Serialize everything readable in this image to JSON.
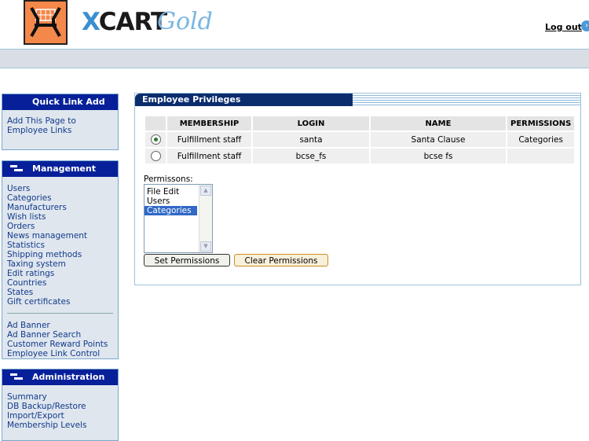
{
  "header": {
    "brand_x": "X",
    "brand_cart": "CART",
    "brand_gold": "Gold",
    "logout_label": "Log out"
  },
  "menus": {
    "quick_link": {
      "title": "Quick Link Add",
      "items": [
        "Add This Page to Employee Links"
      ]
    },
    "management": {
      "title": "Management",
      "items_a": [
        "Users",
        "Categories",
        "Manufacturers",
        "Wish lists",
        "Orders",
        "News management",
        "Statistics",
        "Shipping methods",
        "Taxing system",
        "Edit ratings",
        "Countries",
        "States",
        "Gift certificates"
      ],
      "items_b": [
        "Ad Banner",
        "Ad Banner Search",
        "Customer Reward Points",
        "Employee Link Control"
      ]
    },
    "administration": {
      "title": "Administration",
      "items": [
        "Summary",
        "DB Backup/Restore",
        "Import/Export",
        "Membership Levels"
      ]
    }
  },
  "panel": {
    "title": "Employee Privileges",
    "columns": [
      "MEMBERSHIP",
      "LOGIN",
      "NAME",
      "PERMISSIONS"
    ],
    "rows": [
      {
        "membership": "Fulfillment staff",
        "login": "santa",
        "name": "Santa Clause",
        "permissions": "Categories",
        "selected": true
      },
      {
        "membership": "Fulfillment staff",
        "login": "bcse_fs",
        "name": "bcse fs",
        "permissions": "",
        "selected": false
      }
    ],
    "permissions_label": "Permissons:",
    "permissions_options": [
      "File Edit",
      "Users",
      "Categories"
    ],
    "selected_option": "Categories",
    "set_button": "Set Permissions",
    "clear_button": "Clear Permissions"
  }
}
